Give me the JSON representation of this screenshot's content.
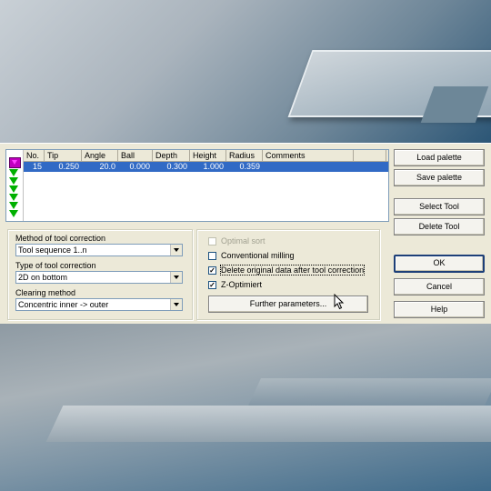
{
  "table": {
    "columns": [
      "No.",
      "Tip",
      "Angle",
      "Ball",
      "Depth",
      "Height",
      "Radius",
      "Comments",
      ""
    ],
    "rows": [
      {
        "no": "15",
        "tip": "0.250",
        "angle": "20.0",
        "ball": "0.000",
        "depth": "0.300",
        "height": "1.000",
        "radius": "0.359",
        "comments": ""
      }
    ],
    "palette_colors": [
      "#c000c0",
      "#00b000"
    ]
  },
  "left_group": {
    "method_label": "Method of tool correction",
    "method_value": "Tool sequence 1..n",
    "type_label": "Type of tool correction",
    "type_value": "2D on bottom",
    "clearing_label": "Clearing method",
    "clearing_value": "Concentric inner -> outer"
  },
  "right_group": {
    "optimal_sort": {
      "label": "Optimal sort",
      "checked": false,
      "enabled": false
    },
    "conventional_milling": {
      "label": "Conventional milling",
      "checked": false
    },
    "delete_original": {
      "label": "Delete original data after tool correction",
      "checked": true
    },
    "z_optimiert": {
      "label": "Z-Optimiert",
      "checked": true
    },
    "further_button": "Further parameters..."
  },
  "buttons": {
    "load_palette": "Load palette",
    "save_palette": "Save palette",
    "select_tool": "Select Tool",
    "delete_tool": "Delete Tool",
    "ok": "OK",
    "cancel": "Cancel",
    "help": "Help"
  },
  "colors": {
    "selection": "#316ac5",
    "dialog_bg": "#ece9d8"
  }
}
